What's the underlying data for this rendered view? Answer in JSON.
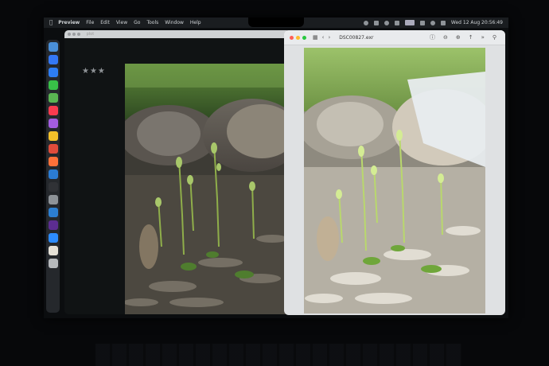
{
  "menubar": {
    "apple_icon": "apple-logo",
    "app_name": "Preview",
    "items": [
      "File",
      "Edit",
      "View",
      "Go",
      "Tools",
      "Window",
      "Help"
    ],
    "clock": "Wed 12 Aug  20:56:49"
  },
  "left_window": {
    "filename": "plot",
    "rating": "★★★"
  },
  "right_window": {
    "title": "DSC00827.exr",
    "traffic_lights": {
      "close": "#ff5f57",
      "minimize": "#febc2e",
      "zoom": "#28c840"
    }
  },
  "dock": {
    "apps": [
      "finder-icon",
      "safari-icon",
      "mail-icon",
      "messages-icon",
      "maps-icon",
      "music-icon",
      "podcasts-icon",
      "notes-icon",
      "chrome-icon",
      "firefox-icon",
      "edge-icon",
      "terminal-icon",
      "settings-icon",
      "vscode-icon",
      "slack-icon",
      "zoom-icon",
      "photos-icon",
      "trash-icon"
    ],
    "colors": [
      "#4a90d9",
      "#3478f6",
      "#2d7df5",
      "#38c048",
      "#5ab552",
      "#fa3b4f",
      "#a35de0",
      "#f4c12a",
      "#e04c3b",
      "#ff7139",
      "#2b7cd3",
      "#303236",
      "#8e9398",
      "#2c7fd1",
      "#5c2d91",
      "#2d8cff",
      "#e6e2d8",
      "#b6b9bc"
    ]
  },
  "colors": {
    "accent": "#0a84ff"
  }
}
